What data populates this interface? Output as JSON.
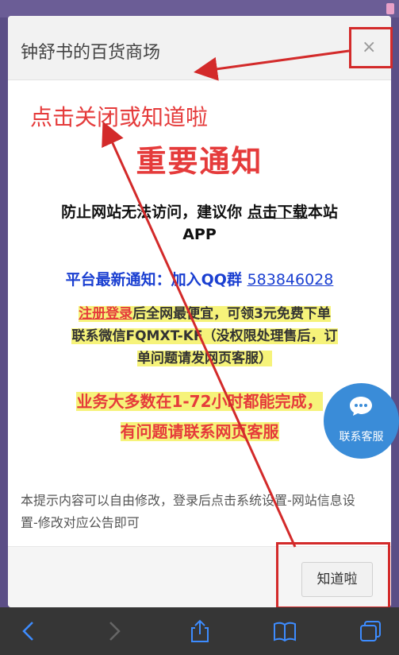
{
  "modal": {
    "title": "钟舒书的百货商场",
    "close_glyph": "×",
    "hint": "点击关闭或知道啦",
    "notice_title": "重要通知",
    "line1_pre": "防止网站无法访问，建议你 ",
    "line1_link": "点击下载",
    "line1_post": "本站",
    "line1_app": "APP",
    "qq_prefix": "平台最新通知：加入QQ群 ",
    "qq_number": "583846028",
    "promo_register": "注册登录",
    "promo_line1": "后全网最便宜，可领3元免费下单",
    "promo_line2": "联系微信FQMXT-KF（没权限处理售后，订",
    "promo_line3": "单问题请发网页客服）",
    "big_line1": "业务大多数在1-72小时都能完成，",
    "big_line2": "有问题请联系网页客服",
    "description": "本提示内容可以自由修改，登录后点击系统设置-网站信息设置-修改对应公告即可",
    "ok_label": "知道啦"
  },
  "chat": {
    "label": "联系客服",
    "icon": "chat-bubble-icon"
  },
  "toolbar": {
    "icons": [
      "back-icon",
      "forward-icon",
      "share-icon",
      "bookmarks-icon",
      "tabs-icon"
    ]
  },
  "colors": {
    "accent_red": "#e53b3b",
    "link_blue": "#1a3fd1",
    "highlight_yellow": "#f6f37a",
    "chat_blue": "#3a8cd8",
    "toolbar_dark": "#363636"
  }
}
